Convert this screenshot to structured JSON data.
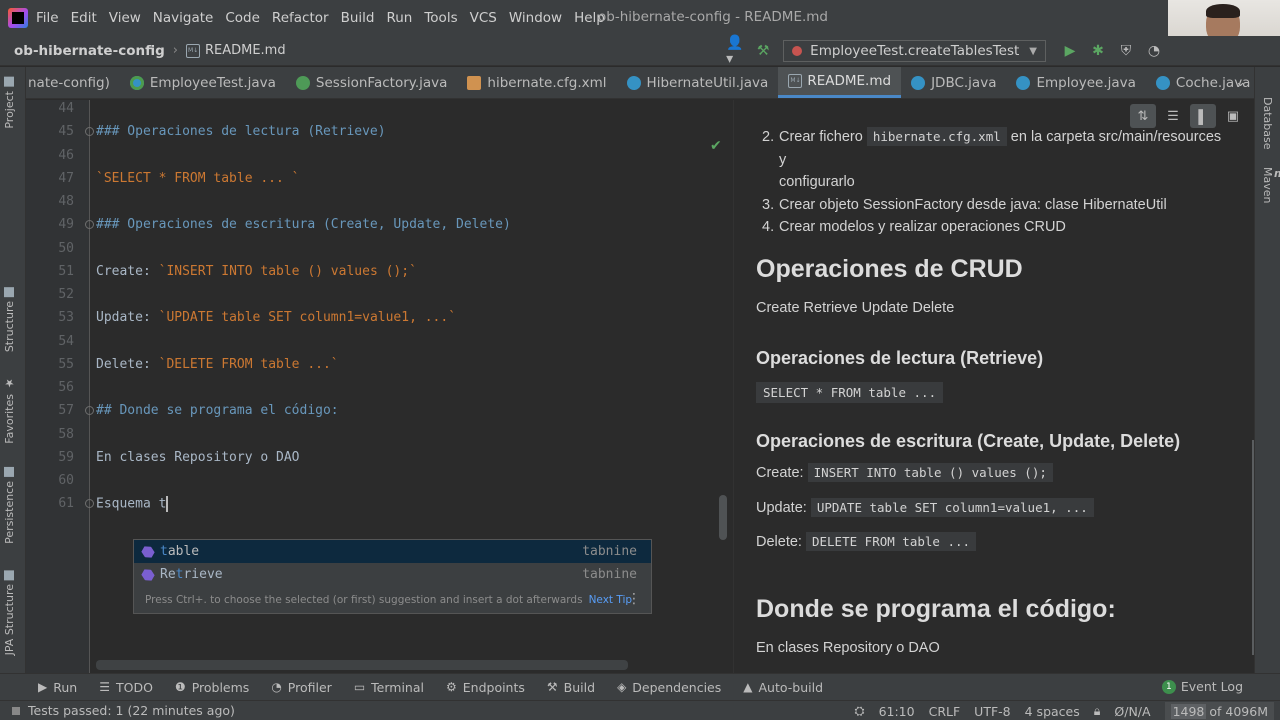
{
  "menubar": {
    "items": [
      "File",
      "Edit",
      "View",
      "Navigate",
      "Code",
      "Refactor",
      "Build",
      "Run",
      "Tools",
      "VCS",
      "Window",
      "Help"
    ],
    "window_title": "ob-hibernate-config - README.md"
  },
  "navbar": {
    "project": "ob-hibernate-config",
    "file": "README.md",
    "run_config": "EmployeeTest.createTablesTest"
  },
  "tabs": [
    {
      "label": "nate-config)",
      "icon": "module-icon",
      "active": false
    },
    {
      "label": "EmployeeTest.java",
      "icon": "java-test-class-icon",
      "active": false
    },
    {
      "label": "SessionFactory.java",
      "icon": "interface-icon",
      "active": false
    },
    {
      "label": "hibernate.cfg.xml",
      "icon": "xml-file-icon",
      "active": false
    },
    {
      "label": "HibernateUtil.java",
      "icon": "class-icon",
      "active": false
    },
    {
      "label": "README.md",
      "icon": "markdown-file-icon",
      "active": true
    },
    {
      "label": "JDBC.java",
      "icon": "class-icon",
      "active": false
    },
    {
      "label": "Employee.java",
      "icon": "class-icon",
      "active": false
    },
    {
      "label": "Coche.java",
      "icon": "class-icon",
      "active": false
    }
  ],
  "left_strip": {
    "project": "Project",
    "structure": "Structure",
    "favorites": "Favorites",
    "persistence": "Persistence",
    "jpa_structure": "JPA Structure"
  },
  "right_strip": {
    "database": "Database",
    "maven": "Maven"
  },
  "editor": {
    "lines": [
      {
        "num": "44",
        "text": "",
        "cls": "c-text"
      },
      {
        "num": "45",
        "text": "### Operaciones de lectura (Retrieve)",
        "cls": "c-head"
      },
      {
        "num": "46",
        "text": "",
        "cls": "c-text"
      },
      {
        "num": "47",
        "text": "`SELECT * FROM table ... `",
        "cls": "c-code"
      },
      {
        "num": "48",
        "text": "",
        "cls": "c-text"
      },
      {
        "num": "49",
        "text": "### Operaciones de escritura (Create, Update, Delete)",
        "cls": "c-head"
      },
      {
        "num": "50",
        "text": "",
        "cls": "c-text"
      },
      {
        "num": "51",
        "prefix": "Create: ",
        "code": "`INSERT INTO table () values ();`",
        "cls": "mixed"
      },
      {
        "num": "52",
        "text": "",
        "cls": "c-text"
      },
      {
        "num": "53",
        "prefix": "Update: ",
        "code": "`UPDATE table SET column1=value1, ...`",
        "cls": "mixed"
      },
      {
        "num": "54",
        "text": "",
        "cls": "c-text"
      },
      {
        "num": "55",
        "prefix": "Delete: ",
        "code": "`DELETE FROM table ...`",
        "cls": "mixed"
      },
      {
        "num": "56",
        "text": "",
        "cls": "c-text"
      },
      {
        "num": "57",
        "text": "## Donde se programa el código:",
        "cls": "c-head"
      },
      {
        "num": "58",
        "text": "",
        "cls": "c-text"
      },
      {
        "num": "59",
        "text": "En clases Repository o DAO",
        "cls": "c-text"
      },
      {
        "num": "60",
        "text": "",
        "cls": "c-text"
      },
      {
        "num": "61",
        "text": "Esquema t",
        "cls": "c-text",
        "caret": true
      }
    ]
  },
  "completion": {
    "items": [
      {
        "label": "table",
        "match": "t",
        "rest": "able",
        "source": "tabnine",
        "selected": true
      },
      {
        "label": "Retrieve",
        "pre": "Re",
        "match": "t",
        "rest": "rieve",
        "source": "tabnine",
        "selected": false
      }
    ],
    "hint": "Press Ctrl+. to choose the selected (or first) suggestion and insert a dot afterwards",
    "hint_link": "Next Tip"
  },
  "preview": {
    "list": [
      {
        "num": "2.",
        "before": "Crear fichero ",
        "code": "hibernate.cfg.xml",
        "after": " en la carpeta src/main/resources y",
        "cont": "configurarlo"
      },
      {
        "num": "3.",
        "before": "Crear objeto SessionFactory desde java: clase HibernateUtil"
      },
      {
        "num": "4.",
        "before": "Crear modelos y realizar operaciones CRUD"
      }
    ],
    "h_crud": "Operaciones de CRUD",
    "p_crud": "Create Retrieve Update Delete",
    "h_lectura": "Operaciones de lectura (Retrieve)",
    "code_select": "SELECT * FROM table ...",
    "h_escritura": "Operaciones de escritura (Create, Update, Delete)",
    "create_label": "Create:",
    "create_code": "INSERT INTO table () values ();",
    "update_label": "Update:",
    "update_code": "UPDATE table SET column1=value1, ...",
    "delete_label": "Delete:",
    "delete_code": "DELETE FROM table ...",
    "h_donde": "Donde se programa el código:",
    "p_donde": "En clases Repository o DAO"
  },
  "toolwindows": [
    "Run",
    "TODO",
    "Problems",
    "Profiler",
    "Terminal",
    "Endpoints",
    "Build",
    "Dependencies",
    "Auto-build"
  ],
  "event_log": {
    "label": "Event Log",
    "count": "1"
  },
  "status": {
    "tests": "Tests passed: 1 (22 minutes ago)",
    "position": "61:10",
    "line_sep": "CRLF",
    "encoding": "UTF-8",
    "indent": "4 spaces",
    "vcs": "Ø/N/A",
    "memory_used": "1498",
    "memory_total": "of 4096M"
  }
}
